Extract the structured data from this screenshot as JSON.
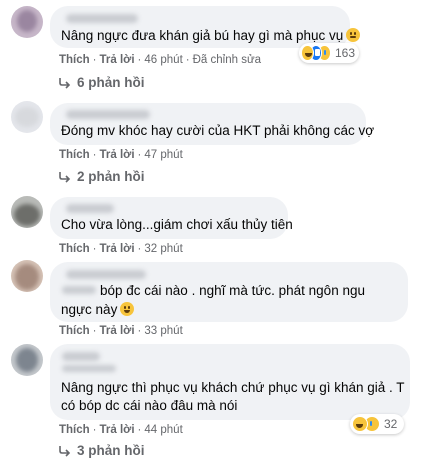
{
  "actions": {
    "like": "Thích",
    "reply": "Trả lời",
    "separator": "·"
  },
  "comments": [
    {
      "text_lines": [
        "Nâng ngực đưa khán giả bú hay gì mà phục vụ"
      ],
      "emoji": "neutral-face",
      "time": "46 phút",
      "edited": "Đã chỉnh sửa",
      "reaction_count": "163",
      "reaction_icons": [
        "haha-icon",
        "like-icon",
        "sad-icon"
      ],
      "replies": "6 phản hồi"
    },
    {
      "text_lines": [
        "Đóng mv khóc hay cười của HKT phải không các vợ"
      ],
      "time": "47 phút",
      "replies": "2 phản hồi"
    },
    {
      "text_lines": [
        "Cho vừa lòng...giám chơi xấu thủy tiên"
      ],
      "time": "32 phút"
    },
    {
      "text_lines": [
        "bóp đc cái nào . nghĩ mà tức. phát ngôn ngu",
        "ngực này"
      ],
      "emoji": "grinning-face",
      "time": "33 phút"
    },
    {
      "text_lines": [
        "Nâng ngực thì phục vụ khách chứ phục vụ gì khán giả . T",
        "có bóp dc cái nào đâu mà nói"
      ],
      "time": "44 phút",
      "reaction_count": "32",
      "reaction_icons": [
        "haha-icon",
        "sad-icon"
      ],
      "replies": "3 phản hồi"
    }
  ],
  "colors": {
    "bubble": "#f0f2f5",
    "meta_text": "#65676b",
    "body_text": "#050505",
    "like_blue": "#1877f2",
    "emoji_yellow": "#f7c43b"
  }
}
